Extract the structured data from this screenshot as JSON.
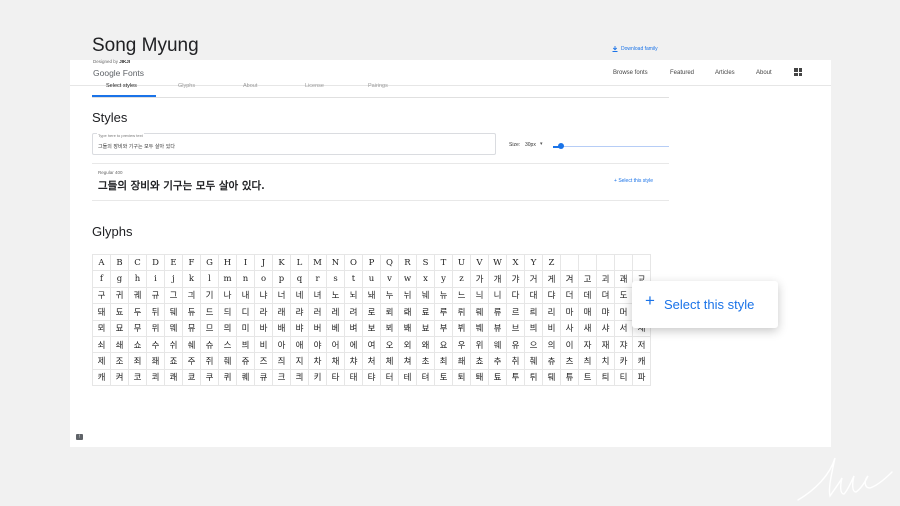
{
  "header": {
    "logo_text": "Google Fonts",
    "nav": [
      {
        "label": "Browse fonts"
      },
      {
        "label": "Featured"
      },
      {
        "label": "Articles"
      },
      {
        "label": "About"
      }
    ],
    "apps_icon": "grid-icon"
  },
  "font": {
    "title": "Song Myung",
    "designed_by_label": "Designed by",
    "designer": "JIKJI",
    "download_label": "Download family"
  },
  "tabs": [
    {
      "label": "Select styles",
      "active": true
    },
    {
      "label": "Glyphs"
    },
    {
      "label": "About"
    },
    {
      "label": "License"
    },
    {
      "label": "Pairings"
    }
  ],
  "styles_section": {
    "heading": "Styles",
    "preview_label": "Type here to preview text",
    "preview_value": "그들의 장비와 기구는 모두 살아 있다",
    "size_label": "Size:",
    "size_value": "30px",
    "slider_value_fraction": 0.05,
    "style_name": "Regular 400",
    "style_sample": "그들의 장비와 기구는 모두 살아 있다.",
    "select_label": "Select this style"
  },
  "glyphs_section": {
    "heading": "Glyphs",
    "glyphs": [
      "A",
      "B",
      "C",
      "D",
      "E",
      "F",
      "G",
      "H",
      "I",
      "J",
      "K",
      "L",
      "M",
      "N",
      "O",
      "P",
      "Q",
      "R",
      "S",
      "T",
      "U",
      "V",
      "W",
      "X",
      "Y",
      "Z",
      "",
      "",
      "",
      "",
      "",
      "f",
      "g",
      "h",
      "i",
      "j",
      "k",
      "l",
      "m",
      "n",
      "o",
      "p",
      "q",
      "r",
      "s",
      "t",
      "u",
      "v",
      "w",
      "x",
      "y",
      "z",
      "가",
      "개",
      "갸",
      "거",
      "게",
      "겨",
      "고",
      "괴",
      "괘",
      "교",
      "구",
      "귀",
      "궤",
      "규",
      "그",
      "긔",
      "기",
      "나",
      "내",
      "냐",
      "너",
      "네",
      "녀",
      "노",
      "뇌",
      "놰",
      "누",
      "뉘",
      "눼",
      "뉴",
      "느",
      "늬",
      "니",
      "다",
      "대",
      "댜",
      "더",
      "데",
      "뎌",
      "도",
      "되",
      "돼",
      "됴",
      "두",
      "뒤",
      "뒈",
      "듀",
      "드",
      "듸",
      "디",
      "라",
      "래",
      "랴",
      "러",
      "레",
      "려",
      "로",
      "뢰",
      "뢔",
      "료",
      "루",
      "뤼",
      "뤠",
      "류",
      "르",
      "릐",
      "리",
      "마",
      "매",
      "먀",
      "머",
      "메",
      "뫼",
      "묘",
      "무",
      "뮈",
      "뭬",
      "뮤",
      "므",
      "믜",
      "미",
      "바",
      "배",
      "뱌",
      "버",
      "베",
      "벼",
      "보",
      "뵈",
      "봬",
      "뵤",
      "부",
      "뷔",
      "붸",
      "뷰",
      "브",
      "븨",
      "비",
      "사",
      "새",
      "샤",
      "서",
      "세",
      "쇠",
      "쇄",
      "쇼",
      "수",
      "쉬",
      "쉐",
      "슈",
      "스",
      "븨",
      "비",
      "아",
      "애",
      "야",
      "어",
      "에",
      "여",
      "오",
      "외",
      "왜",
      "요",
      "우",
      "위",
      "웨",
      "유",
      "으",
      "의",
      "이",
      "자",
      "재",
      "쟈",
      "저",
      "제",
      "조",
      "죄",
      "좨",
      "죠",
      "주",
      "쥐",
      "줴",
      "쥬",
      "즈",
      "즤",
      "지",
      "차",
      "채",
      "챠",
      "처",
      "체",
      "쳐",
      "초",
      "최",
      "쵀",
      "쵸",
      "추",
      "취",
      "췌",
      "츄",
      "츠",
      "츼",
      "치",
      "카",
      "캐",
      "캐",
      "켜",
      "코",
      "쾨",
      "쾌",
      "쿄",
      "쿠",
      "퀴",
      "퀘",
      "큐",
      "크",
      "킈",
      "키",
      "타",
      "태",
      "탸",
      "터",
      "테",
      "텨",
      "토",
      "퇴",
      "퇘",
      "툐",
      "투",
      "튀",
      "퉤",
      "튜",
      "트",
      "틔",
      "티",
      "파"
    ],
    "callout_label": "Select this style"
  }
}
